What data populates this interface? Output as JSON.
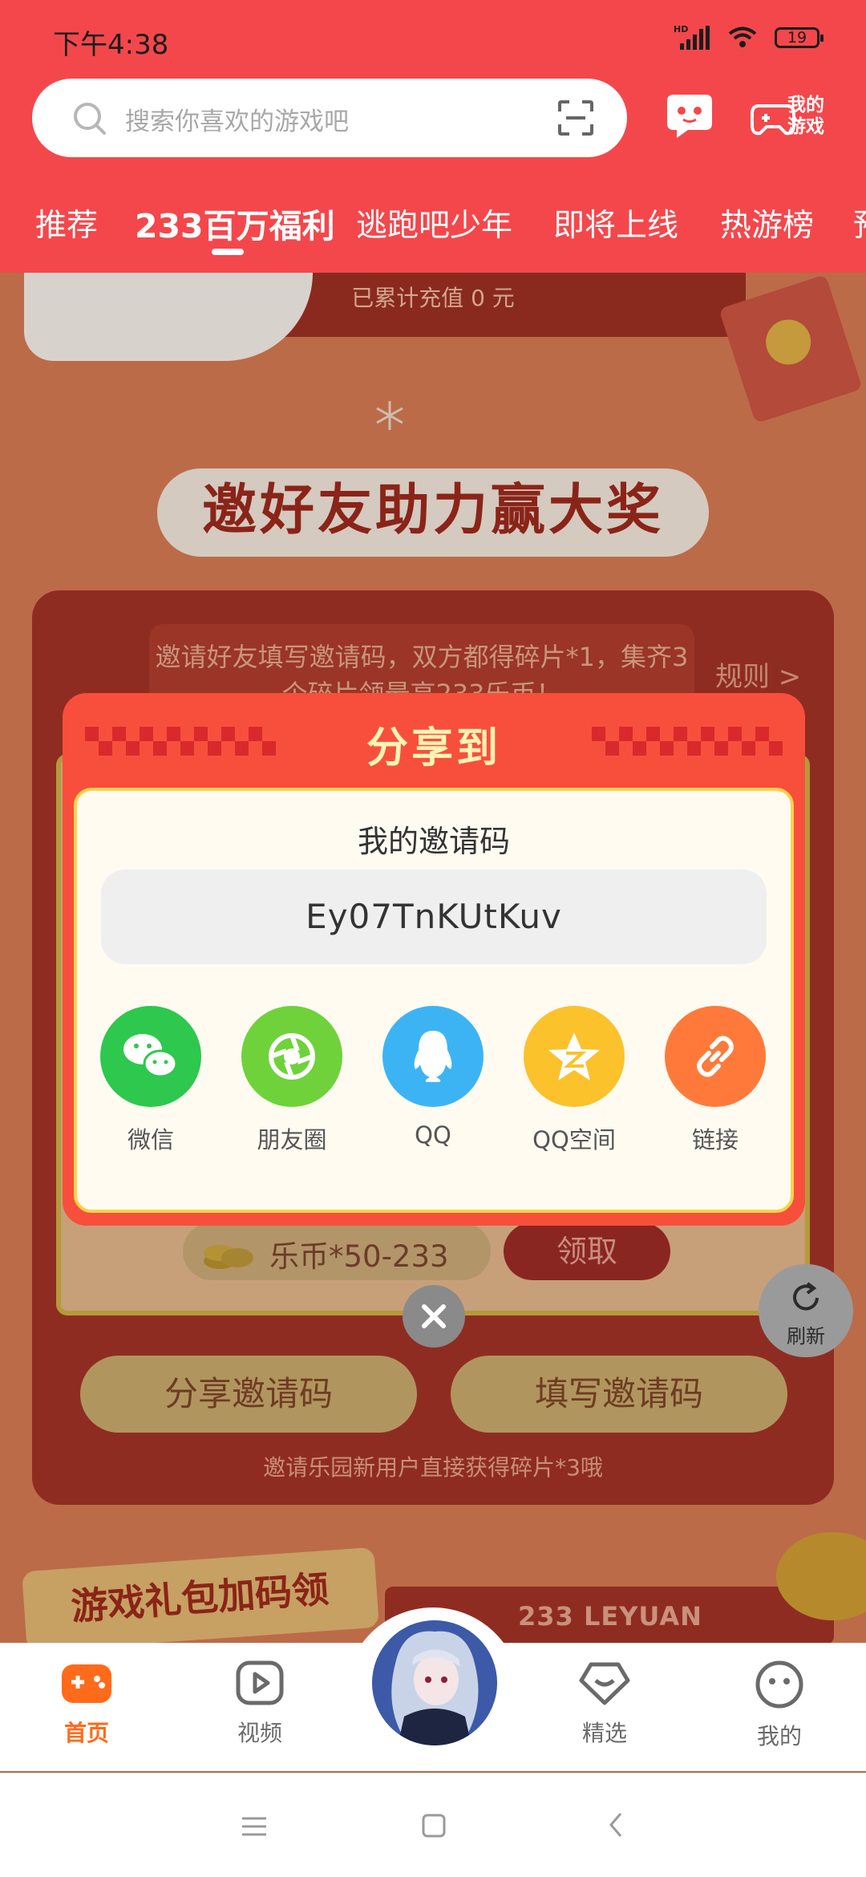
{
  "status_bar": {
    "time": "下午4:38",
    "network": "HD",
    "battery": "19"
  },
  "header": {
    "search_placeholder": "搜索你喜欢的游戏吧",
    "my_games_label": "我的游戏",
    "tabs": [
      {
        "label": "推荐"
      },
      {
        "label": "233百万福利"
      },
      {
        "label": "逃跑吧少年"
      },
      {
        "label": "即将上线"
      },
      {
        "label": "热游榜"
      },
      {
        "label": "预"
      }
    ],
    "active_tab": "233百万福利"
  },
  "background_page": {
    "recharge_total": "已累计充值 0 元",
    "event_title": "邀好友助力赢大奖",
    "invite_desc": "邀请好友填写邀请码，双方都得碎片*1，集齐3个碎片领最高233乐币！",
    "rules_link": "规则 >",
    "reward_label": "乐币*50-233",
    "claim_button": "领取",
    "share_code_button": "分享邀请码",
    "enter_code_button": "填写邀请码",
    "footer_note": "邀请乐园新用户直接获得碎片*3哦",
    "gift_section_title": "游戏礼包加码领",
    "brand_band": "233 LEYUAN"
  },
  "refresh_button": "刷新",
  "share_dialog": {
    "title": "分享到",
    "subtitle": "我的邀请码",
    "invite_code": "Ey07TnKUtKuv",
    "options": [
      {
        "label": "微信",
        "icon": "wechat-icon",
        "color": "#2dc84d"
      },
      {
        "label": "朋友圈",
        "icon": "moments-icon",
        "color": "#6fd23a"
      },
      {
        "label": "QQ",
        "icon": "qq-icon",
        "color": "#3cb4f4"
      },
      {
        "label": "QQ空间",
        "icon": "qzone-icon",
        "color": "#fbc22c"
      },
      {
        "label": "链接",
        "icon": "link-icon",
        "color": "#ff7a3a"
      }
    ]
  },
  "bottom_nav": {
    "items": [
      {
        "label": "首页",
        "icon": "gamepad-icon",
        "active": true
      },
      {
        "label": "视频",
        "icon": "video-icon",
        "active": false
      },
      {
        "label": "精选",
        "icon": "featured-icon",
        "active": false
      },
      {
        "label": "我的",
        "icon": "profile-icon",
        "active": false
      }
    ]
  },
  "colors": {
    "header_red": "#f4474b",
    "dialog_red": "#f74f3c",
    "title_yellow": "#fff3b4",
    "active_orange": "#ff6b1a"
  }
}
